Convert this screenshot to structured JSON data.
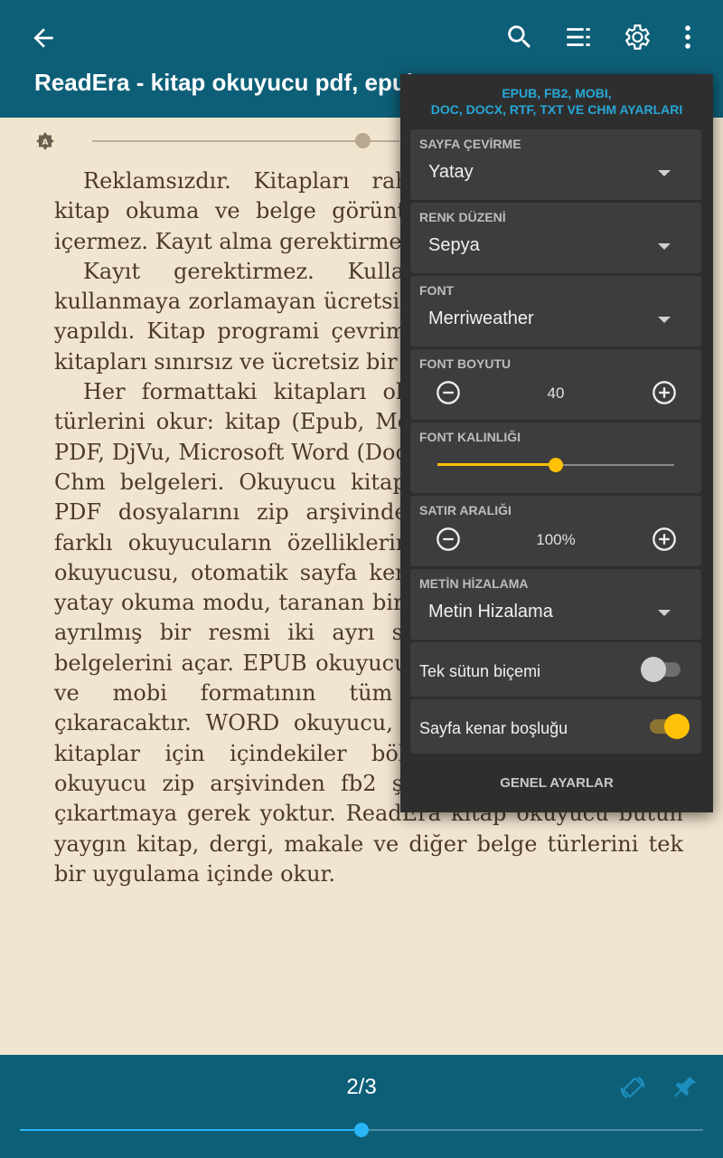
{
  "header": {
    "title": "ReadEra - kitap okuyucu pdf, epub"
  },
  "content": {
    "paragraphs": [
      "Reklamsızdır. Kitapları rahatça okuyun. ReadEra kitap okuma ve belge görüntüleme programı reklam içermez. Kayıt alma gerektirmez.",
      "Kayıt gerektirmez. Kullanıcıları kayıt hizmeti kullanmaya zorlamayan ücretsiz bir okuyucu uygulaması yapıldı. Kitap programi çevrimdışı çalışır ve tarayıcıda kitapları sınırsız ve ücretsiz bir şekilde.",
      "Her formattaki kitapları okur. Bu okuyucu format türlerini okur: kitap (Epub, Mobi, AZW3), Fb2; işletme PDF, DjVu, Microsoft Word (Doc, Docx, Rtf), ODT, TXT ve Chm belgeleri. Okuyucu kitapları, Microsoft Word ve PDF dosyalarını zip arşivinden açar. Kitap okuyucu, farklı okuyucuların özelliklerini biraraya getirdi. PDF okuyucusu, otomatik sayfa kenar boşluğu kırpmaya ve yatay okuma modu, taranan bir pdf kitabında iki sayfaya ayrılmış bir resmi iki ayrı sayfa olarak gösterir ve belgelerini açar. EPUB okuyucusu, okuyucular için epub ve mobi formatının tüm üstünlüklerini ortaya çıkaracaktır. WORD okuyucu, bölüm başlıklarına göre kitaplar için içindekiler bölümünü oluşturur. FB2 okuyucu zip arşivinden fb2 şeklindeki kitapları açar; çıkartmaya gerek yoktur. ReadEra kitap okuyucu bütün yaygın kitap, dergi, makale ve diğer belge türlerini tek bir uygulama içinde okur."
    ]
  },
  "panel": {
    "heading_line1": "EPUB, FB2, MOBI,",
    "heading_line2": "DOC, DOCX, RTF, TXT VE CHM AYARLARI",
    "page_turn": {
      "label": "SAYFA ÇEVİRME",
      "value": "Yatay"
    },
    "color_scheme": {
      "label": "RENK DÜZENİ",
      "value": "Sepya"
    },
    "font": {
      "label": "FONT",
      "value": "Merriweather"
    },
    "font_size": {
      "label": "FONT BOYUTU",
      "value": "40"
    },
    "font_weight": {
      "label": "FONT KALINLIĞI",
      "level": 0.5
    },
    "line_spacing": {
      "label": "SATIR ARALIĞI",
      "value": "100%"
    },
    "alignment": {
      "label": "METİN HİZALAMA",
      "value": "Metin Hizalama"
    },
    "single_column": {
      "label": "Tek sütun biçemi",
      "on": false
    },
    "page_margins": {
      "label": "Sayfa kenar boşluğu",
      "on": true
    },
    "general_settings": "GENEL AYARLAR"
  },
  "footer": {
    "page": "2/3",
    "progress": 0.5
  },
  "colors": {
    "bar": "#0d5f78",
    "accent": "#ffc107",
    "progress": "#29b6f6",
    "paper": "#f2e5d0"
  }
}
